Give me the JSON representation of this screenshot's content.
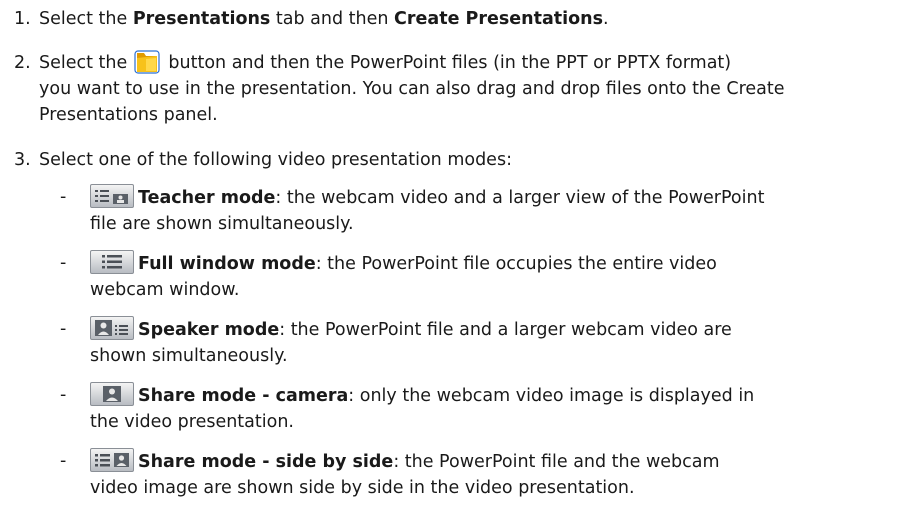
{
  "steps": [
    {
      "num": "1.",
      "pre": "Select the ",
      "b1": "Presentations",
      "mid": " tab and then ",
      "b2": "Create Presentations",
      "post": "."
    },
    {
      "num": "2.",
      "pre": "Select the",
      "text_line1": " button and then the PowerPoint files (in the PPT or PPTX format)",
      "text_rest": "you want to use in the presentation. You can also drag and drop files onto the Create Presentations panel."
    },
    {
      "num": "3.",
      "text": "Select one of the following video presentation modes:"
    }
  ],
  "modes": [
    {
      "icon": "teacher-mode-icon",
      "name": "Teacher mode",
      "desc_line1": ": the webcam video and a larger view of the PowerPoint",
      "desc_line2": "file are shown simultaneously."
    },
    {
      "icon": "full-window-mode-icon",
      "name": "Full window mode",
      "desc_line1": ": the PowerPoint file occupies the entire video",
      "desc_line2": "webcam window."
    },
    {
      "icon": "speaker-mode-icon",
      "name": "Speaker mode",
      "desc_line1": ": the PowerPoint file and a larger webcam video are",
      "desc_line2": "shown simultaneously."
    },
    {
      "icon": "share-mode-camera-icon",
      "name": "Share mode - camera",
      "desc_line1": ": only the webcam video image is displayed in",
      "desc_line2": "the video presentation."
    },
    {
      "icon": "share-mode-side-by-side-icon",
      "name": "Share mode - side by side",
      "desc_line1": ": the PowerPoint file and the webcam",
      "desc_line2": "video image are shown side by side in the video presentation."
    }
  ],
  "dash": "-",
  "colors": {
    "text": "#1a1a1a",
    "folder": "#f2b400",
    "icon_bg": "#c9cdd2",
    "icon_border": "#8a8f96",
    "icon_dark": "#4a4f56"
  }
}
